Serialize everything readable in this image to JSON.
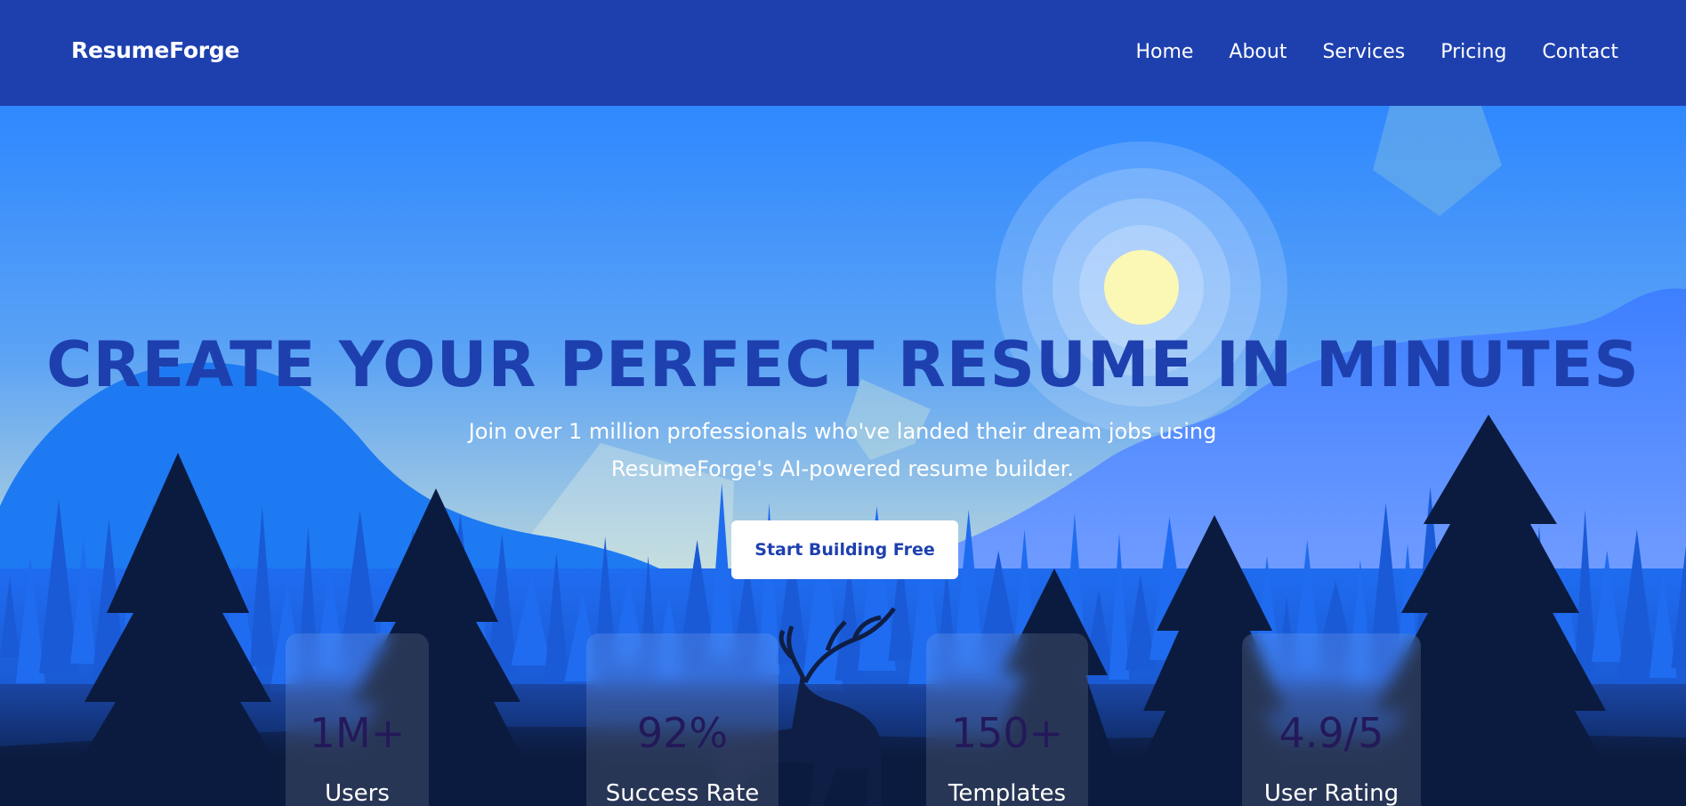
{
  "nav": {
    "brand": "ResumeForge",
    "links": [
      "Home",
      "About",
      "Services",
      "Pricing",
      "Contact"
    ]
  },
  "hero": {
    "headline": "CREATE YOUR PERFECT RESUME IN MINUTES",
    "subtext_line1": "Join over 1 million professionals who've landed their dream jobs using",
    "subtext_line2": "ResumeForge's AI-powered resume builder.",
    "cta_label": "Start Building Free"
  },
  "stats": [
    {
      "value": "1M+",
      "label": "Users"
    },
    {
      "value": "92%",
      "label": "Success Rate"
    },
    {
      "value": "150+",
      "label": "Templates"
    },
    {
      "value": "4.9/5",
      "label": "User Rating"
    }
  ],
  "colors": {
    "nav_bg": "#1e40af",
    "sky_top": "#2f88ff",
    "headline": "#1e40af",
    "tree_dark": "#0b1b3f",
    "sun": "#fbf7b4"
  },
  "icons": {
    "deer": "deer-silhouette-icon",
    "sun": "sun-icon",
    "tree": "pine-tree-icon"
  }
}
